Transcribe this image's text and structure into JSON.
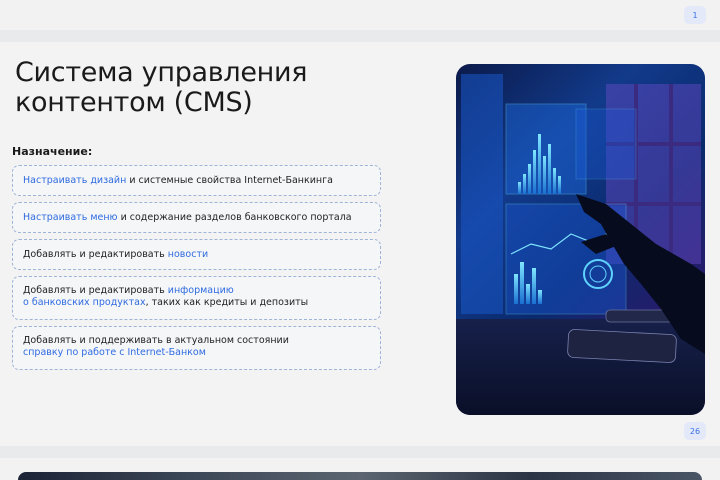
{
  "slides": {
    "top_page_number": "1",
    "main_page_number": "26"
  },
  "main": {
    "title_line1": "Система управления",
    "title_line2": "контентом (CMS)",
    "subtitle": "Назначение:",
    "cards": [
      {
        "hl": "Настраивать дизайн",
        "text": " и системные свойства Internet-Банкинга"
      },
      {
        "hl": "Настраивать меню",
        "text": " и содержание разделов банковского портала"
      },
      {
        "text": "Добавлять и редактировать ",
        "hl": "новости"
      },
      {
        "line1_text": "Добавлять и редактировать ",
        "line1_hl": "информацию",
        "line2_hl": "о банковских продуктах",
        "line2_text": ", таких как кредиты и депозиты"
      },
      {
        "line1_text": "Добавлять и поддерживать в актуальном состоянии",
        "line2_hl": "справку по работе с Internet-Банком"
      }
    ]
  }
}
